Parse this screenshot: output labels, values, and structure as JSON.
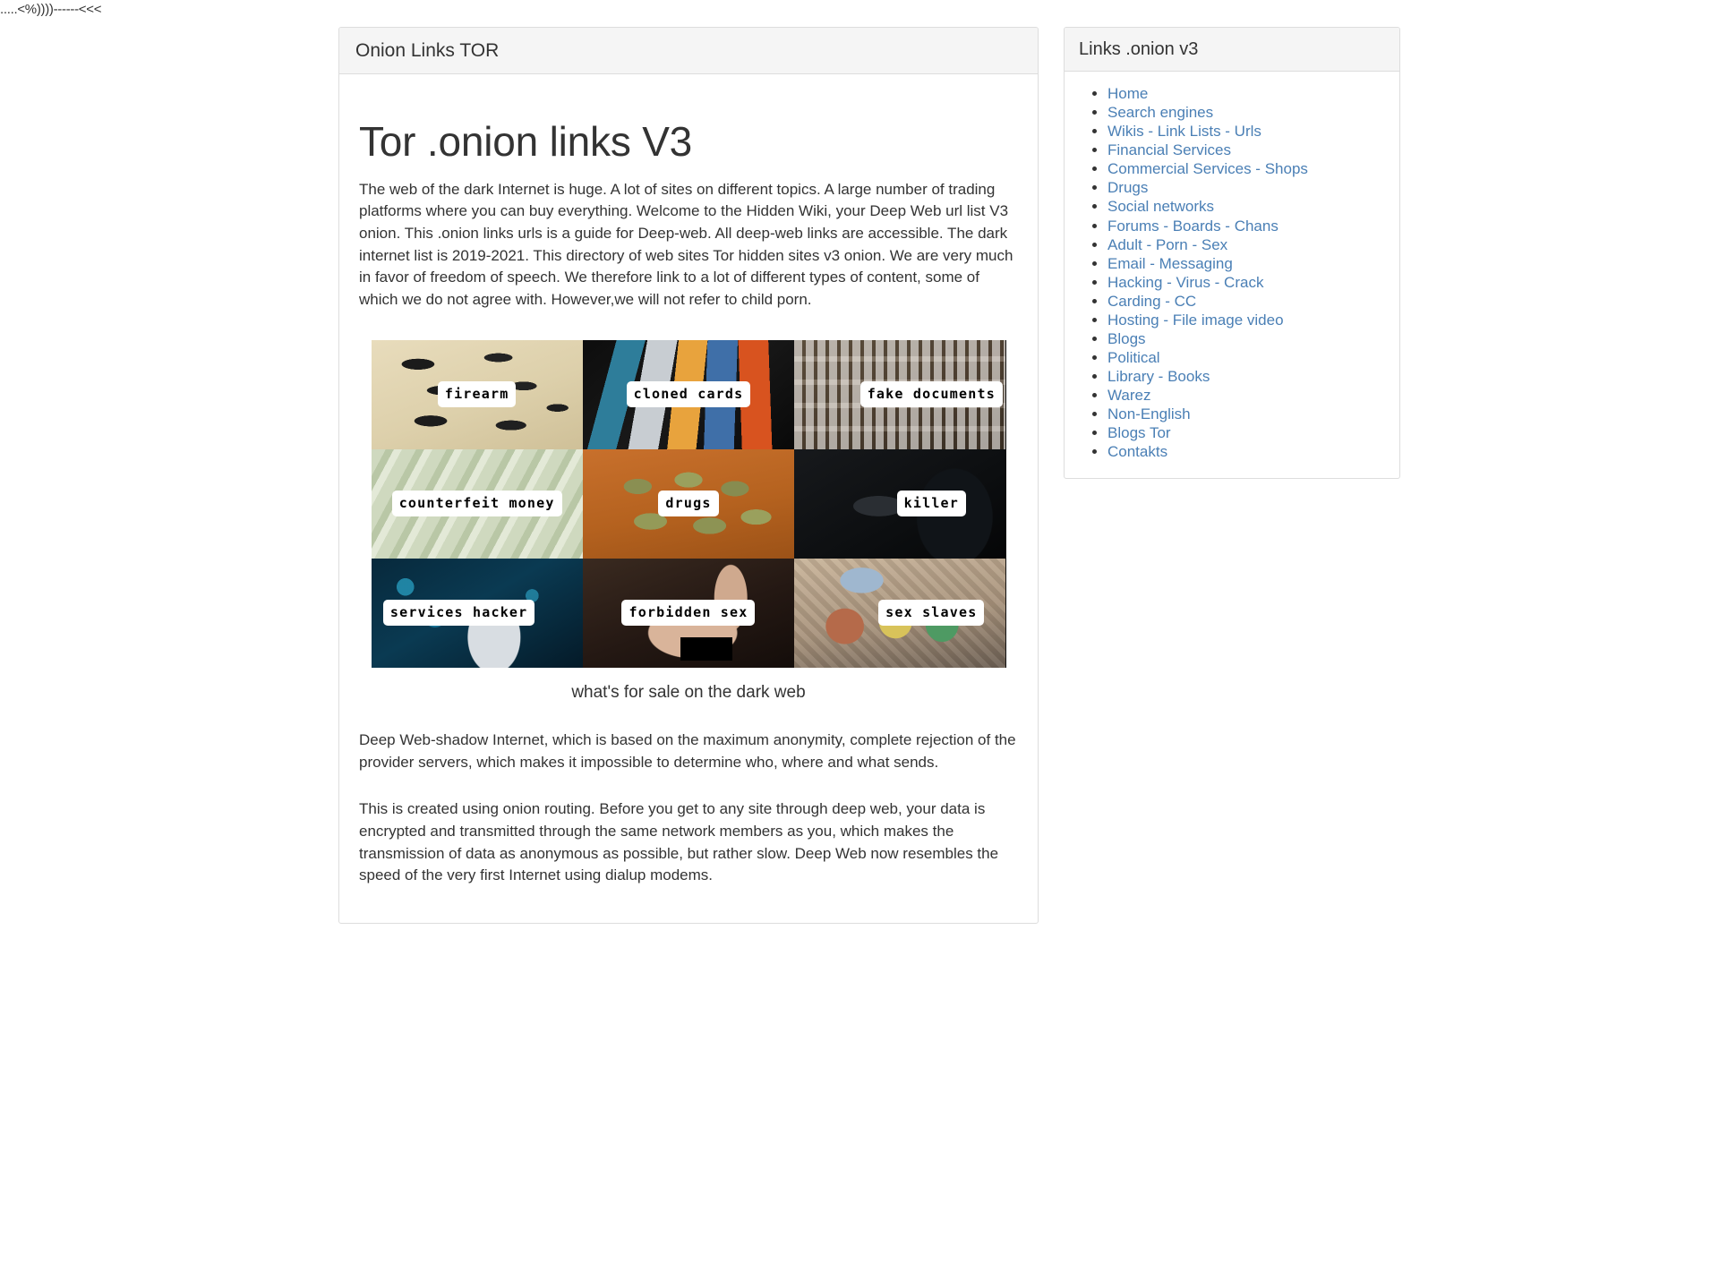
{
  "ascii_banner": ".....<%))))------<<<",
  "main_panel": {
    "title": "Onion Links TOR",
    "article_title": "Tor .onion links V3",
    "intro_paragraph": "The web of the dark Internet is huge. A lot of sites on different topics. A large number of trading platforms where you can buy everything. Welcome to the Hidden Wiki, your Deep Web url list V3 onion. This .onion links urls is a guide for Deep-web. All deep-web links are accessible. The dark internet list is 2019-2021. This directory of web sites Tor hidden sites v3 onion. We are very much in favor of freedom of speech. We therefore link to a lot of different types of content, some of which we do not agree with. However,we will not refer to child porn.",
    "figure_caption": "what's for sale on the dark web",
    "figure_cells": [
      {
        "label": "firearm",
        "icon": "firearm-photo"
      },
      {
        "label": "cloned cards",
        "icon": "cloned-cards-photo"
      },
      {
        "label": "fake documents",
        "icon": "fake-documents-photo"
      },
      {
        "label": "counterfeit money",
        "icon": "counterfeit-money-photo"
      },
      {
        "label": "drugs",
        "icon": "drugs-photo"
      },
      {
        "label": "killer",
        "icon": "killer-photo"
      },
      {
        "label": "services hacker",
        "icon": "services-hacker-photo"
      },
      {
        "label": "forbidden sex",
        "icon": "forbidden-sex-photo"
      },
      {
        "label": "sex slaves",
        "icon": "sex-slaves-photo"
      }
    ],
    "paragraph_2": " Deep Web-shadow Internet, which is based on the maximum anonymity, complete rejection of the provider servers, which makes it impossible to determine who, where and what sends.",
    "paragraph_3": " This is created using onion routing. Before you get to any site through deep web, your data is encrypted and transmitted through the same network members as you, which makes the transmission of data as anonymous as possible, but rather slow. Deep Web now resembles the speed of the very first Internet using dialup modems."
  },
  "sidebar": {
    "title": "Links .onion v3",
    "links": [
      {
        "label": "Home"
      },
      {
        "label": "Search engines"
      },
      {
        "label": "Wikis - Link Lists - Urls"
      },
      {
        "label": "Financial Services"
      },
      {
        "label": "Commercial Services - Shops"
      },
      {
        "label": "Drugs"
      },
      {
        "label": "Social networks"
      },
      {
        "label": "Forums - Boards - Chans"
      },
      {
        "label": "Adult - Porn - Sex"
      },
      {
        "label": "Email - Messaging"
      },
      {
        "label": "Hacking - Virus - Crack"
      },
      {
        "label": "Carding - CC"
      },
      {
        "label": "Hosting - File image video"
      },
      {
        "label": "Blogs"
      },
      {
        "label": "Political"
      },
      {
        "label": "Library - Books"
      },
      {
        "label": "Warez"
      },
      {
        "label": "Non-English"
      },
      {
        "label": "Blogs Tor"
      },
      {
        "label": "Contakts"
      }
    ]
  },
  "colors": {
    "link": "#4a7fb5",
    "text": "#333333",
    "panel_border": "#dddddd",
    "panel_heading_bg": "#f5f5f5",
    "page_bg": "#ffffff"
  }
}
